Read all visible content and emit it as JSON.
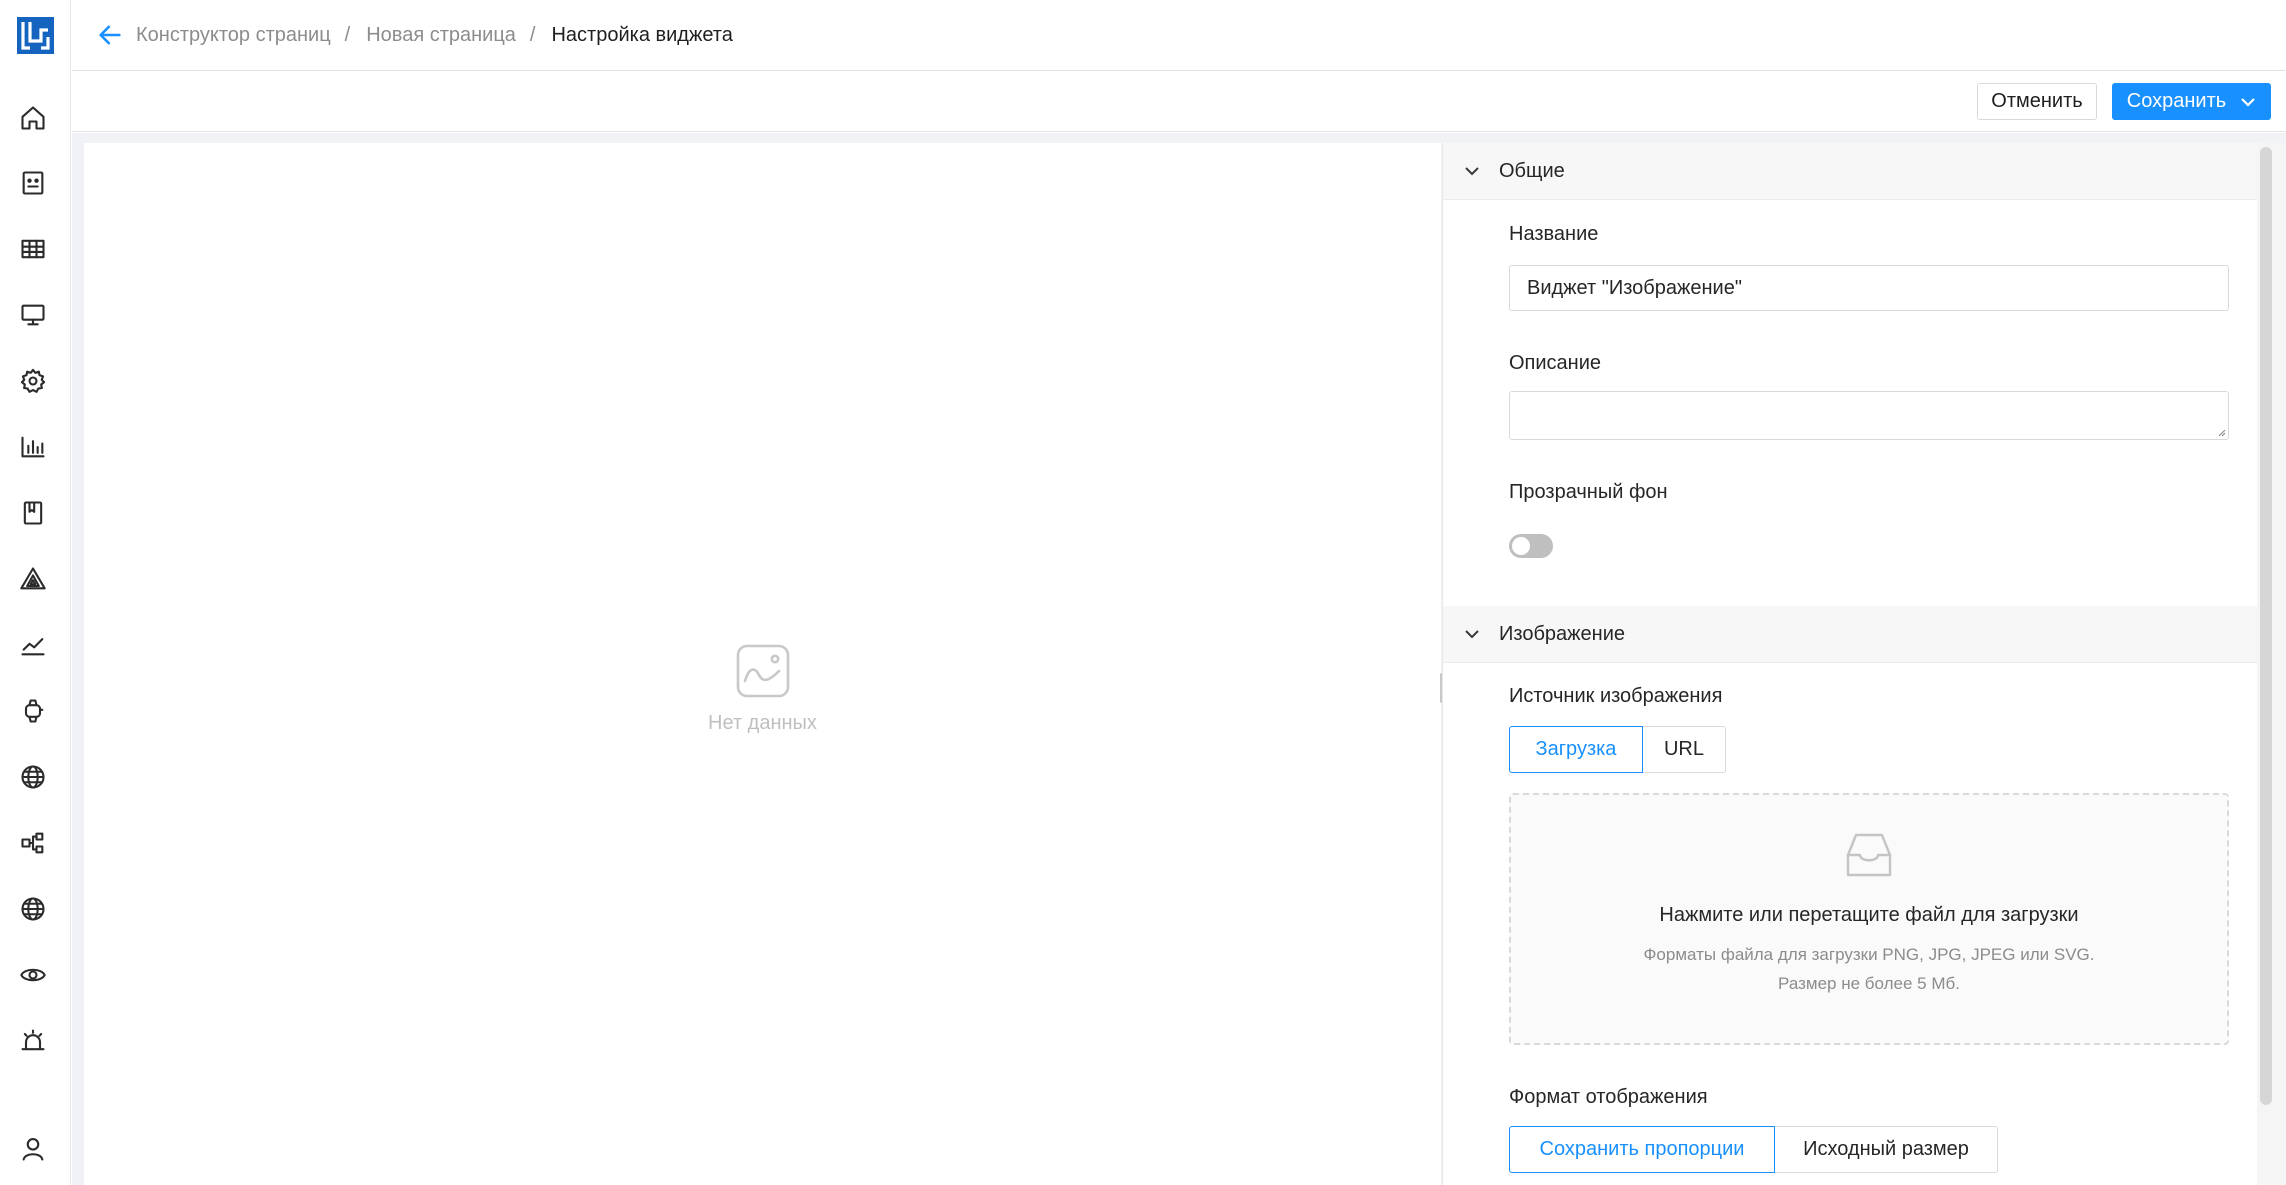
{
  "breadcrumb": {
    "items": [
      "Конструктор страниц",
      "Новая страница",
      "Настройка виджета"
    ],
    "separator": "/"
  },
  "toolbar": {
    "cancel_label": "Отменить",
    "save_label": "Сохранить"
  },
  "sidebar": {
    "items": [
      "home-icon",
      "card-icon",
      "table-icon",
      "monitor-icon",
      "gear-icon",
      "bar-chart-icon",
      "book-icon",
      "triangle-icon",
      "line-chart-icon",
      "watch-icon",
      "globe-icon",
      "hierarchy-icon",
      "globe-icon",
      "eye-icon",
      "alarm-icon",
      "user-icon"
    ]
  },
  "preview": {
    "empty_text": "Нет данных"
  },
  "general": {
    "title": "Общие",
    "name_label": "Название",
    "name_value": "Виджет \"Изображение\"",
    "description_label": "Описание",
    "description_value": "",
    "transparent_label": "Прозрачный фон",
    "transparent_enabled": false
  },
  "image": {
    "title": "Изображение",
    "source_label": "Источник изображения",
    "source_options": [
      "Загрузка",
      "URL"
    ],
    "source_selected": "Загрузка",
    "upload_title": "Нажмите или перетащите файл для загрузки",
    "upload_hint_1": "Форматы файла для загрузки PNG, JPG, JPEG или SVG.",
    "upload_hint_2": "Размер не более 5 Мб.",
    "format_label": "Формат отображения",
    "format_options": [
      "Сохранить пропорции",
      "Исходный размер"
    ],
    "format_selected": "Сохранить пропорции"
  },
  "colors": {
    "accent": "#1890ff",
    "logo": "#1565c0"
  }
}
